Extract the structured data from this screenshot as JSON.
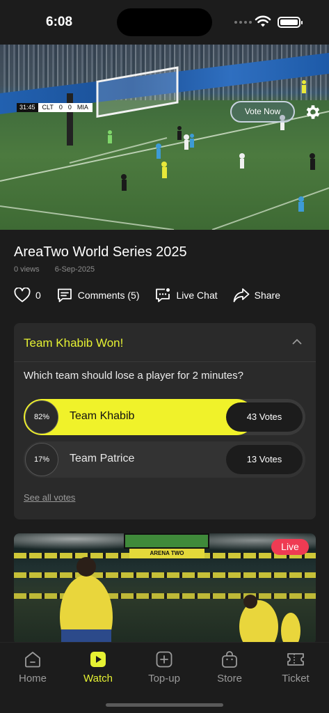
{
  "status_bar": {
    "time": "6:08"
  },
  "video": {
    "scorebug": {
      "clock": "31:45",
      "home": "CLT",
      "home_score": "0",
      "away_score": "0",
      "away": "MIA"
    },
    "vote_now_label": "Vote Now",
    "icons": {
      "settings": "gear-icon"
    }
  },
  "stream": {
    "title": "AreaTwo World Series 2025",
    "views": "0 views",
    "date": "6-Sep-2025",
    "likes": "0",
    "comments_label": "Comments (5)",
    "live_chat_label": "Live Chat",
    "share_label": "Share"
  },
  "poll": {
    "result_title": "Team Khabib Won!",
    "question": "Which team should lose a player for 2 minutes?",
    "options": [
      {
        "percent_label": "82%",
        "percent": 82,
        "name": "Team Khabib",
        "votes": "43 Votes",
        "winner": true
      },
      {
        "percent_label": "17%",
        "percent": 17,
        "name": "Team Patrice",
        "votes": "13 Votes",
        "winner": false
      }
    ],
    "see_all_label": "See all votes"
  },
  "live_card": {
    "badge": "Live",
    "screen_text": "ARENA TWO"
  },
  "nav": {
    "items": [
      {
        "label": "Home",
        "icon": "home-icon"
      },
      {
        "label": "Watch",
        "icon": "play-icon",
        "active": true
      },
      {
        "label": "Top-up",
        "icon": "plus-square-icon"
      },
      {
        "label": "Store",
        "icon": "bag-icon"
      },
      {
        "label": "Ticket",
        "icon": "ticket-icon"
      }
    ]
  },
  "colors": {
    "accent": "#e6f233",
    "background": "#1c1c1c",
    "card": "#2a2a2a",
    "live": "#ef3b53"
  }
}
